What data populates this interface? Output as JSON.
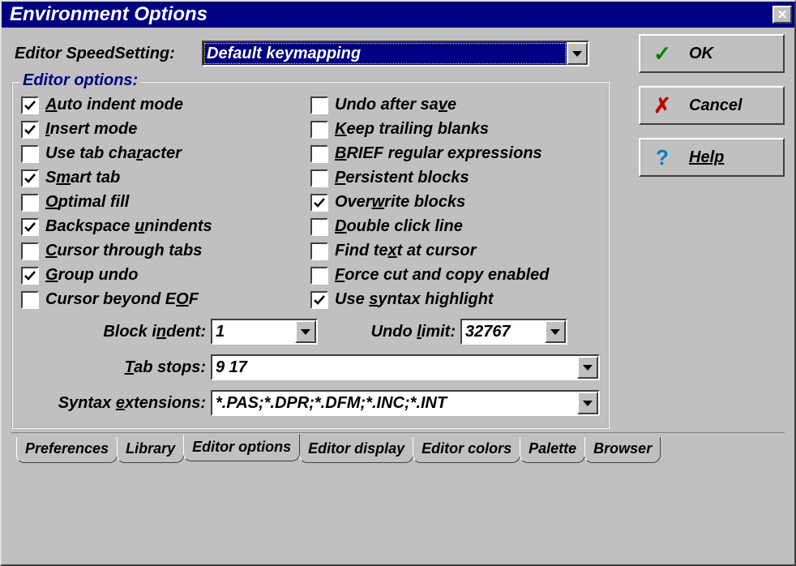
{
  "window": {
    "title": "Environment Options"
  },
  "speed": {
    "label": "Editor SpeedSetting:",
    "value": "Default keymapping"
  },
  "buttons": {
    "ok": {
      "label": "OK",
      "glyph": "✓",
      "color": "#008000"
    },
    "cancel": {
      "label": "Cancel",
      "glyph": "✗",
      "color": "#c00000"
    },
    "help": {
      "label": "Help",
      "glyph": "?",
      "color": "#0080c0",
      "underline": true
    }
  },
  "editor_options": {
    "legend": "Editor options:",
    "left": [
      {
        "pre": "",
        "u": "A",
        "post": "uto indent mode",
        "checked": true
      },
      {
        "pre": "",
        "u": "I",
        "post": "nsert mode",
        "checked": true
      },
      {
        "pre": "Use tab cha",
        "u": "r",
        "post": "acter",
        "checked": false
      },
      {
        "pre": "S",
        "u": "m",
        "post": "art tab",
        "checked": true
      },
      {
        "pre": "",
        "u": "O",
        "post": "ptimal fill",
        "checked": false
      },
      {
        "pre": "Backspace ",
        "u": "u",
        "post": "nindents",
        "checked": true
      },
      {
        "pre": "",
        "u": "C",
        "post": "ursor through tabs",
        "checked": false
      },
      {
        "pre": "",
        "u": "G",
        "post": "roup undo",
        "checked": true
      },
      {
        "pre": "Cursor beyond E",
        "u": "O",
        "post": "F",
        "checked": false
      }
    ],
    "right": [
      {
        "pre": "Undo after sa",
        "u": "v",
        "post": "e",
        "checked": false
      },
      {
        "pre": "",
        "u": "K",
        "post": "eep trailing blanks",
        "checked": false
      },
      {
        "pre": "",
        "u": "B",
        "post": "RIEF regular expressions",
        "checked": false
      },
      {
        "pre": "",
        "u": "P",
        "post": "ersistent blocks",
        "checked": false
      },
      {
        "pre": "Over",
        "u": "w",
        "post": "rite blocks",
        "checked": true
      },
      {
        "pre": "",
        "u": "D",
        "post": "ouble click line",
        "checked": false
      },
      {
        "pre": "Find te",
        "u": "x",
        "post": "t at cursor",
        "checked": false
      },
      {
        "pre": "",
        "u": "F",
        "post": "orce cut and copy enabled",
        "checked": false
      },
      {
        "pre": "Use ",
        "u": "s",
        "post": "yntax highlight",
        "checked": true
      }
    ]
  },
  "fields": {
    "block_indent": {
      "label_pre": "Block i",
      "label_u": "n",
      "label_post": "dent:",
      "value": "1"
    },
    "undo_limit": {
      "label_pre": "Undo ",
      "label_u": "l",
      "label_post": "imit:",
      "value": "32767"
    },
    "tab_stops": {
      "label_pre": "",
      "label_u": "T",
      "label_post": "ab stops:",
      "value": "9 17"
    },
    "syntax_ext": {
      "label_pre": "Syntax ",
      "label_u": "e",
      "label_post": "xtensions:",
      "value": "*.PAS;*.DPR;*.DFM;*.INC;*.INT"
    }
  },
  "tabs": {
    "items": [
      "Preferences",
      "Library",
      "Editor options",
      "Editor display",
      "Editor colors",
      "Palette",
      "Browser"
    ],
    "active_index": 2
  }
}
